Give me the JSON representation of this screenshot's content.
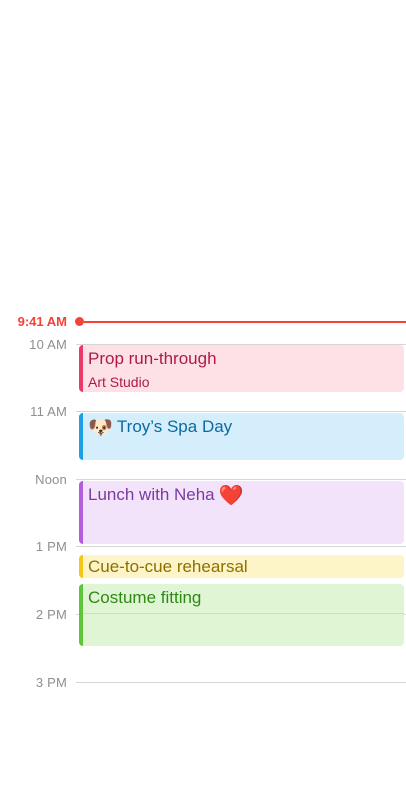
{
  "current_time": "9:41 AM",
  "hours": [
    "10 AM",
    "11 AM",
    "Noon",
    "1 PM",
    "2 PM",
    "3 PM"
  ],
  "events": [
    {
      "title": "Prop run-through",
      "location": "Art Studio",
      "color": "#ea3a6a"
    },
    {
      "title": "Troy’s Spa Day",
      "emoji": "🐶",
      "icon": "dog-face-icon",
      "color": "#1e9fe6"
    },
    {
      "title": "Lunch with Neha",
      "emoji": "❤️",
      "icon": "red-heart-icon",
      "color": "#b55edc"
    },
    {
      "title": "Cue-to-cue rehearsal",
      "color": "#f5c518"
    },
    {
      "title": "Costume fitting",
      "color": "#5cc53a"
    }
  ],
  "colors": {
    "now_indicator": "#f44336",
    "hour_label": "#8e8e93",
    "gridline": "#d6d6d6"
  }
}
